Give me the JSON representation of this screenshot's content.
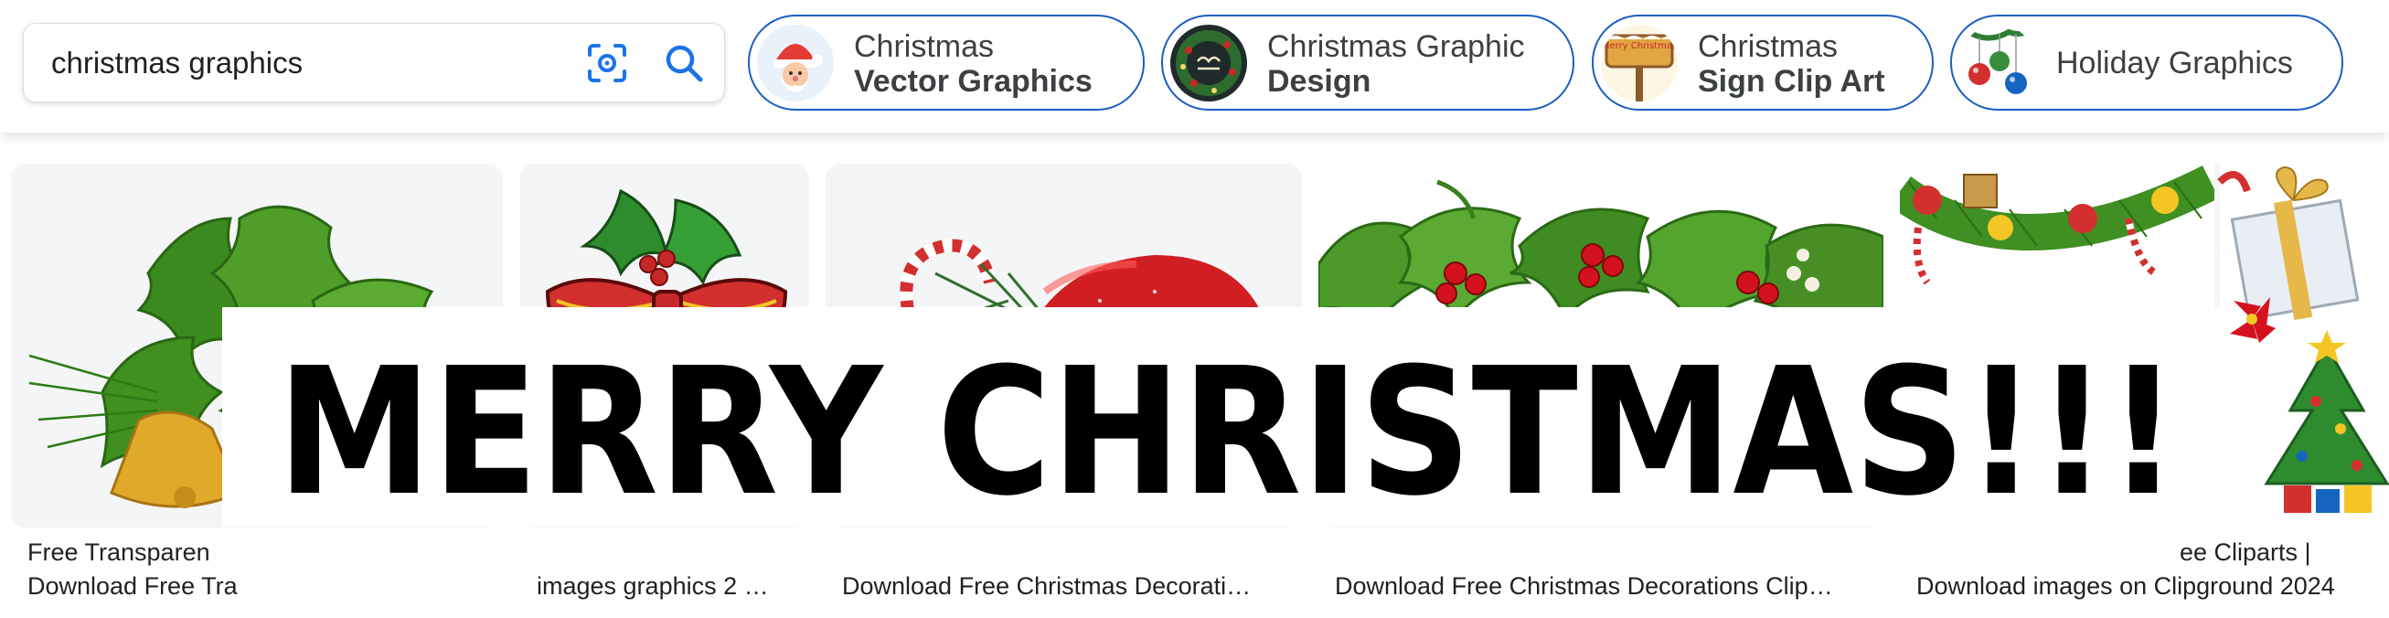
{
  "search": {
    "query": "christmas graphics",
    "lens_icon": "camera-lens-icon",
    "search_icon": "magnifier-icon"
  },
  "chips": [
    {
      "line1": "Christmas",
      "line2": "Vector Graphics"
    },
    {
      "line1": "Christmas Graphic",
      "line2": "Design"
    },
    {
      "line1": "Christmas",
      "line2": "Sign Clip Art",
      "thumb_text": "Merry Christmas"
    },
    {
      "line1": "Holiday Graphics"
    }
  ],
  "results": [
    {
      "caption_line1": "Free Transparen",
      "caption_line2": "Download Free Transparent Christm…"
    },
    {
      "caption_line2": "images graphics 2 …"
    },
    {
      "caption_line2": "Download Free Christmas Decorati…"
    },
    {
      "caption_line2": "Download Free Christmas Decorations Clip…"
    },
    {
      "caption_line1": "ee Cliparts |",
      "caption_line2": "Download images on Clipground 2024"
    }
  ],
  "banner": {
    "text": "MERRY CHRISTMAS!!!"
  },
  "colors": {
    "chip_border": "#1a5fc1",
    "accent_blue": "#1a73e8",
    "holly_green": "#3b8a1f",
    "berry_red": "#d4121d"
  }
}
